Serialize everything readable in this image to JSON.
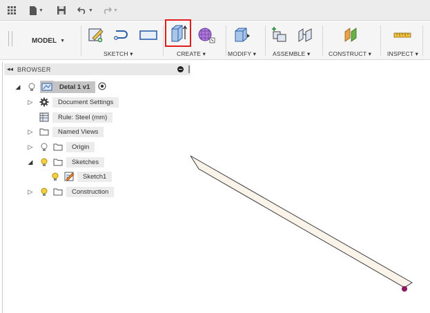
{
  "quick_access": {
    "icons": [
      "grid-icon",
      "file-icon",
      "save-icon",
      "undo-icon",
      "redo-icon"
    ]
  },
  "toolbar": {
    "workspace": "MODEL",
    "groups": [
      {
        "label": "SKETCH",
        "tools": [
          "create-sketch-icon",
          "line-icon",
          "rectangle-icon"
        ]
      },
      {
        "label": "CREATE",
        "tools": [
          "extrude-icon",
          "form-icon"
        ]
      },
      {
        "label": "MODIFY",
        "tools": [
          "press-pull-icon"
        ]
      },
      {
        "label": "ASSEMBLE",
        "tools": [
          "new-component-icon",
          "joint-icon"
        ]
      },
      {
        "label": "CONSTRUCT",
        "tools": [
          "offset-plane-icon"
        ]
      },
      {
        "label": "INSPECT",
        "tools": [
          "measure-icon"
        ]
      }
    ],
    "active_tool": "extrude-icon",
    "active_color": "#e01b1b"
  },
  "browser": {
    "title": "BROWSER",
    "root": {
      "label": "Detal 1 v1"
    },
    "items": [
      {
        "label": "Document Settings"
      },
      {
        "label": "Rule: Steel (mm)"
      },
      {
        "label": "Named Views"
      },
      {
        "label": "Origin"
      },
      {
        "label": "Sketches"
      },
      {
        "label": "Sketch1"
      },
      {
        "label": "Construction"
      }
    ]
  },
  "canvas": {
    "body_color": "#faf3ea",
    "point_color": "#8a1a5c"
  }
}
